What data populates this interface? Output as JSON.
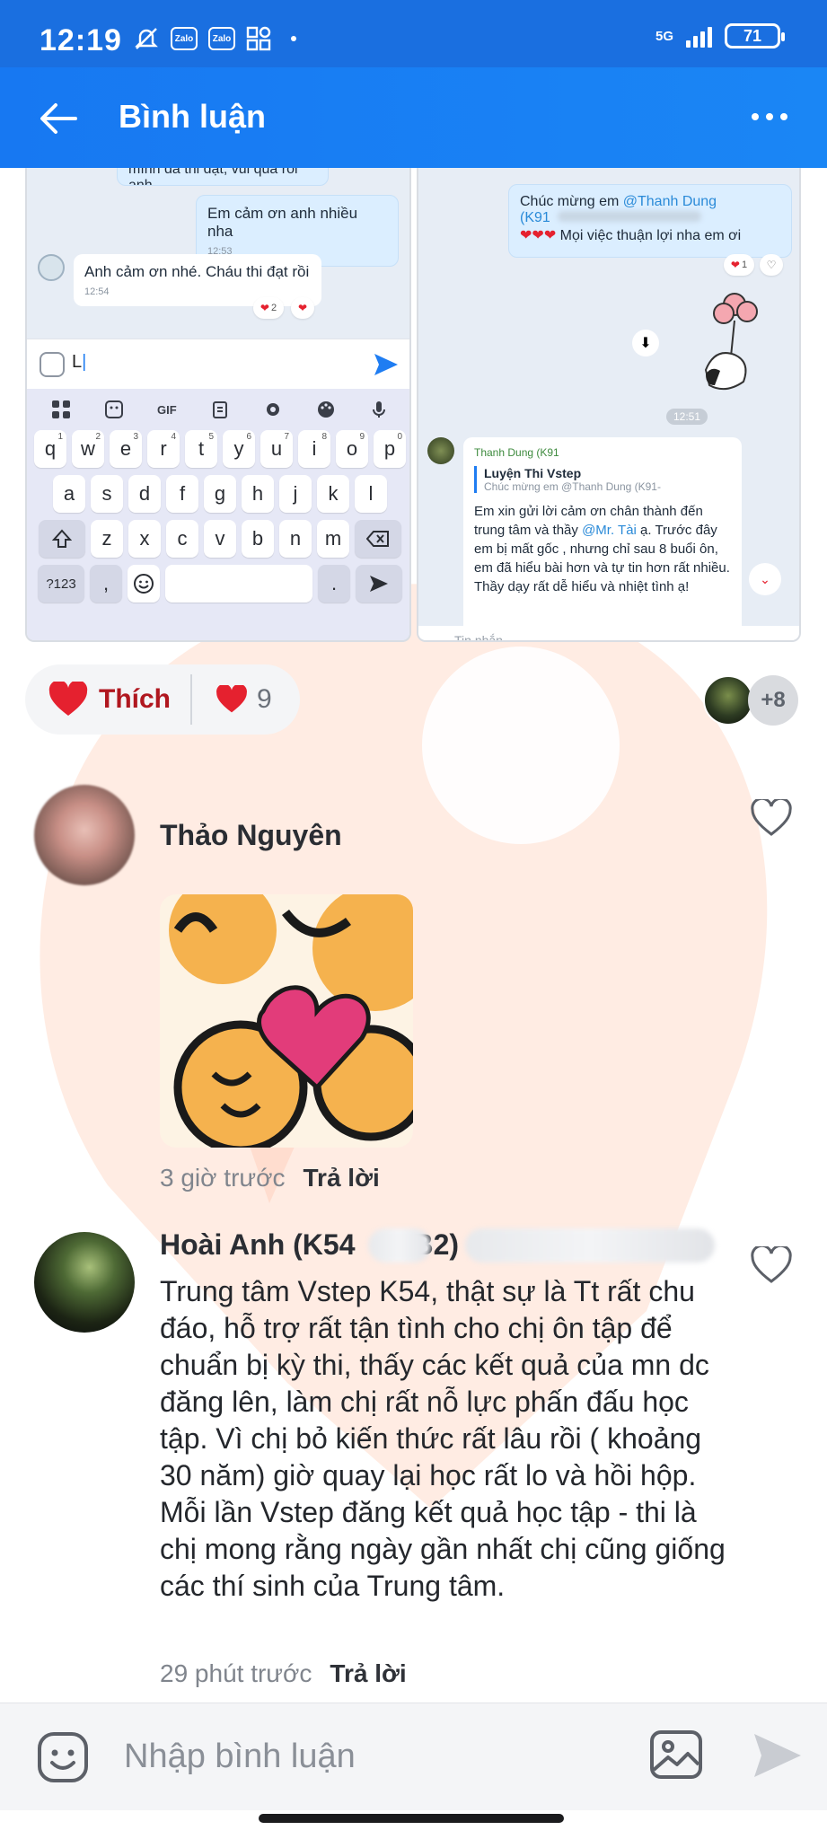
{
  "status_bar": {
    "time": "12:19",
    "zalo_1": "Zalo",
    "zalo_2": "Zalo",
    "network": "5G",
    "battery": "71"
  },
  "header": {
    "title": "Bình luận",
    "back_icon": "arrow-left-icon",
    "more_icon": "more-horizontal-icon"
  },
  "screenshot_left": {
    "msg_top_partial": "mình đã thi đạt, vui quá rồi anh",
    "msg_out": "Em cảm ơn anh nhiều nha",
    "msg_out_time": "12:53",
    "msg_in": "Anh cảm ơn nhé. Cháu thi đạt rồi",
    "msg_in_time": "12:54",
    "msg_in_react_count": "2",
    "input_text": "L",
    "kb_tools": [
      "grid-icon",
      "sticker-icon",
      "GIF",
      "clipboard-icon",
      "settings-icon",
      "palette-icon",
      "mic-icon"
    ],
    "kb_rows": [
      [
        {
          "k": "q",
          "s": "1"
        },
        {
          "k": "w",
          "s": "2"
        },
        {
          "k": "e",
          "s": "3"
        },
        {
          "k": "r",
          "s": "4"
        },
        {
          "k": "t",
          "s": "5"
        },
        {
          "k": "y",
          "s": "6"
        },
        {
          "k": "u",
          "s": "7"
        },
        {
          "k": "i",
          "s": "8"
        },
        {
          "k": "o",
          "s": "9"
        },
        {
          "k": "p",
          "s": "0"
        }
      ],
      [
        {
          "k": "a"
        },
        {
          "k": "s"
        },
        {
          "k": "d"
        },
        {
          "k": "f"
        },
        {
          "k": "g"
        },
        {
          "k": "h"
        },
        {
          "k": "j"
        },
        {
          "k": "k"
        },
        {
          "k": "l"
        }
      ],
      [
        {
          "k": "z"
        },
        {
          "k": "x"
        },
        {
          "k": "c"
        },
        {
          "k": "v"
        },
        {
          "k": "b"
        },
        {
          "k": "n"
        },
        {
          "k": "m"
        }
      ]
    ],
    "kb_symbols": "?123",
    "kb_comma": ",",
    "kb_period": "."
  },
  "screenshot_right": {
    "msg_out_line1": "Chúc mừng em",
    "mention": "@Thanh Dung",
    "msg_out_line2": "(K91",
    "msg_out_line3": "Mọi việc thuận lợi nha em ơi",
    "react_count": "1",
    "time_chip": "12:51",
    "sender": "Thanh Dung (K91",
    "quote_title": "Luyện Thi Vstep",
    "quote_sub": "Chúc mừng em @Thanh Dung (K91-",
    "body_1": "Em xin gửi lời cảm ơn chân thành đến trung tâm và thầy",
    "body_mention": "@Mr. Tài",
    "body_2": "ạ. Trước đây em bị mất gốc , nhưng chỉ sau 8 buổi ôn, em đã hiểu bài hơn và tự tin hơn rất nhiều. Thầy dạy rất dễ hiểu và nhiệt tình ạ!",
    "input_placeholder": "Tin nhắn"
  },
  "like_bar": {
    "like_label": "Thích",
    "like_count": "9",
    "more_reactors": "+8"
  },
  "comments": [
    {
      "name": "Thảo Nguyên",
      "time_ago": "3 giờ trước",
      "reply_label": "Trả lời"
    },
    {
      "name_prefix": "Hoài Anh (K54",
      "name_suffix": "B2)",
      "text": "Trung tâm Vstep K54, thật sự là Tt rất chu đáo, hỗ trợ rất tận tình cho chị ôn tập để chuẩn bị kỳ thi, thấy các kết quả của mn dc đăng lên, làm chị rất nỗ lực phấn đấu học tập. Vì chị bỏ kiến thức rất lâu rồi ( khoảng 30 năm) giờ quay lại học rất lo và hồi hộp. Mỗi lần Vstep đăng kết quả học tập - thi là chị mong rằng ngày gần nhất chị cũng giống các thí sinh của Trung tâm.",
      "time_ago": "29 phút trước",
      "reply_label": "Trả lời"
    }
  ],
  "composer": {
    "placeholder": "Nhập bình luận"
  },
  "colors": {
    "header_blue": "#1778f2",
    "like_red": "#e5212f",
    "watermark": "#ffe3d6"
  }
}
